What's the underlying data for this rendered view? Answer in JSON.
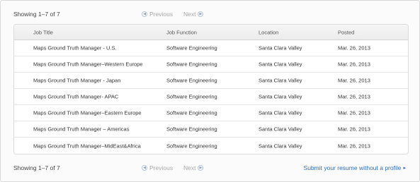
{
  "top_pager": {
    "showing": "Showing 1–7 of 7",
    "previous": "Previous",
    "next": "Next"
  },
  "table": {
    "columns": [
      "Job Title",
      "Job Function",
      "Location",
      "Posted"
    ],
    "rows": [
      [
        "Maps Ground Truth Manager - U.S.",
        "Software Engineering",
        "Santa Clara Valley",
        "Mar. 26, 2013"
      ],
      [
        "Maps Ground Truth Manager–Western Europe",
        "Software Engineering",
        "Santa Clara Valley",
        "Mar. 26, 2013"
      ],
      [
        "Maps Ground Truth Manager - Japan",
        "Software Engineering",
        "Santa Clara Valley",
        "Mar. 26, 2013"
      ],
      [
        "Maps Ground Truth Manager- APAC",
        "Software Engineering",
        "Santa Clara Valley",
        "Mar. 26, 2013"
      ],
      [
        "Maps Ground Truth Manager–Eastern Europe",
        "Software Engineering",
        "Santa Clara Valley",
        "Mar. 26, 2013"
      ],
      [
        "Maps Ground Truth Manager – Americas",
        "Software Engineering",
        "Santa Clara Valley",
        "Mar. 26, 2013"
      ],
      [
        "Maps Ground Truth Manager–MidEast&Africa",
        "Software Engineering",
        "Santa Clara Valley",
        "Mar. 26, 2013"
      ]
    ]
  },
  "bottom_pager": {
    "showing": "Showing 1–7 of 7",
    "previous": "Previous",
    "next": "Next",
    "submit_link": "Submit your resume without a profile"
  },
  "icons": {
    "previous": "chevron-left-circle-icon",
    "next": "chevron-right-circle-icon",
    "submit": "caret-right-icon"
  },
  "colors": {
    "link": "#2f6fb2",
    "disabled_nav": "#a8a8a8"
  }
}
